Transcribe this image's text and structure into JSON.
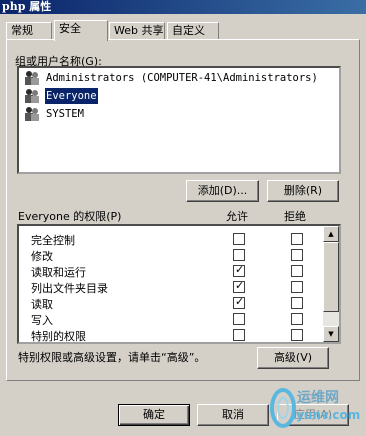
{
  "window": {
    "title": "php 属性"
  },
  "tabs": [
    {
      "label": "常规",
      "active": false
    },
    {
      "label": "安全",
      "active": true
    },
    {
      "label": "Web 共享",
      "active": false
    },
    {
      "label": "自定义",
      "active": false
    }
  ],
  "users": {
    "label": "组或用户名称(G):",
    "items": [
      {
        "name": "Administrators (COMPUTER-41\\Administrators)",
        "selected": false
      },
      {
        "name": "Everyone",
        "selected": true
      },
      {
        "name": "SYSTEM",
        "selected": false
      }
    ],
    "add_label": "添加(D)...",
    "remove_label": "删除(R)"
  },
  "permissions": {
    "label": "Everyone 的权限(P)",
    "allow_header": "允许",
    "deny_header": "拒绝",
    "rows": [
      {
        "name": "完全控制",
        "allow": false,
        "deny": false
      },
      {
        "name": "修改",
        "allow": false,
        "deny": false
      },
      {
        "name": "读取和运行",
        "allow": true,
        "deny": false
      },
      {
        "name": "列出文件夹目录",
        "allow": true,
        "deny": false
      },
      {
        "name": "读取",
        "allow": true,
        "deny": false
      },
      {
        "name": "写入",
        "allow": false,
        "deny": false
      },
      {
        "name": "特别的权限",
        "allow": false,
        "deny": false
      }
    ]
  },
  "advanced": {
    "note": "特别权限或高级设置，请单击“高级”。",
    "button_label": "高级(V)"
  },
  "footer": {
    "ok_label": "确定",
    "cancel_label": "取消",
    "apply_label": "应用(A)"
  },
  "watermark": {
    "line1": "运维网",
    "line2": "iyunv.com"
  },
  "colors": {
    "selection": "#0a246a",
    "titlebar": "#0a246a",
    "face": "#d4d0c8"
  }
}
